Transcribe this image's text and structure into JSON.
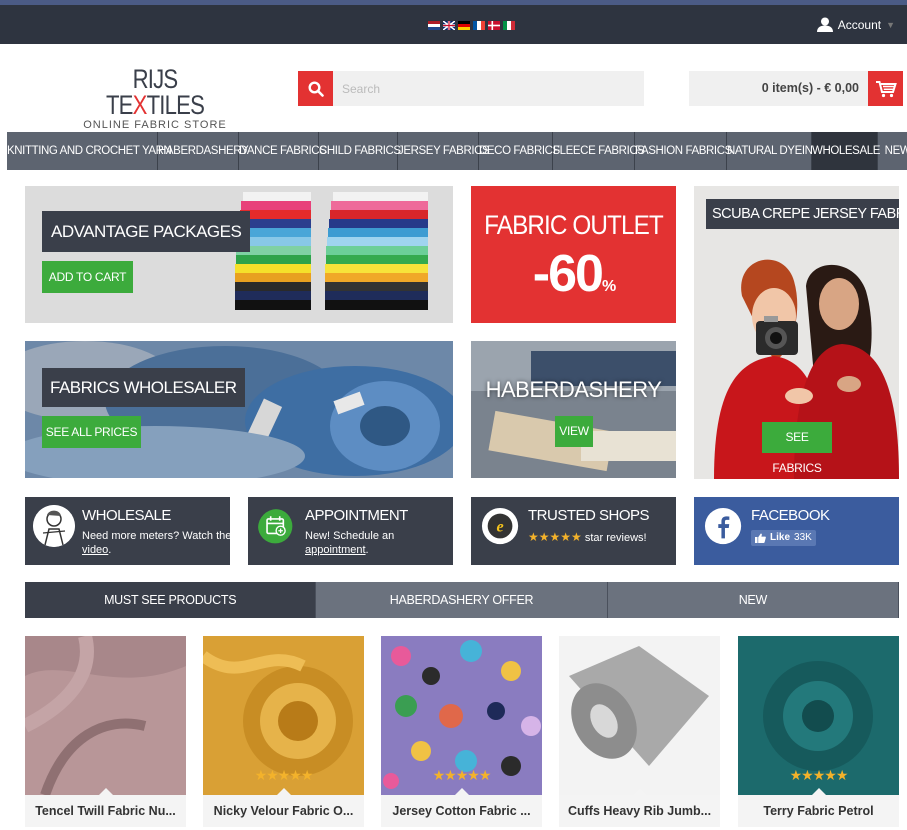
{
  "topbar": {
    "account_label": "Account",
    "flags": [
      "nl",
      "uk",
      "de",
      "fr",
      "dk",
      "it"
    ]
  },
  "logo": {
    "line1_a": "RIJS TE",
    "line1_x": "X",
    "line1_b": "TILES",
    "line2": "ONLINE FABRIC STORE"
  },
  "search": {
    "placeholder": "Search"
  },
  "cart": {
    "summary": "0 item(s) - € 0,00"
  },
  "nav": {
    "items": [
      {
        "label": "KNITTING AND CROCHET YARN",
        "active": false
      },
      {
        "label": "HABERDASHERY",
        "active": false
      },
      {
        "label": "DANCE FABRICS",
        "active": false
      },
      {
        "label": "CHILD FABRICS",
        "active": false
      },
      {
        "label": "JERSEY FABRICS",
        "active": false
      },
      {
        "label": "DECO FABRICS",
        "active": false
      },
      {
        "label": "FLEECE FABRICS",
        "active": false
      },
      {
        "label": "FASHION FABRICS",
        "active": false
      },
      {
        "label": "NATURAL DYEING",
        "active": false
      },
      {
        "label": "WHOLESALE",
        "active": true
      },
      {
        "label": "NEW",
        "active": false
      }
    ]
  },
  "banners": {
    "advantage": {
      "title": "ADVANTAGE PACKAGES",
      "button": "ADD TO CART"
    },
    "outlet": {
      "title": "FABRIC OUTLET",
      "discount": "-60",
      "percent": "%"
    },
    "scuba": {
      "title": "SCUBA CREPE JERSEY FABRIC",
      "button": "SEE FABRICS"
    },
    "wholesaler": {
      "title": "FABRICS WHOLESALER",
      "button": "SEE ALL PRICES"
    },
    "haberdashery": {
      "title": "HABERDASHERY",
      "button": "VIEW"
    }
  },
  "info_boxes": {
    "wholesale": {
      "title": "WHOLESALE",
      "text": "Need more meters? Watch the ",
      "link": "video",
      "end": "."
    },
    "appointment": {
      "title": "APPOINTMENT",
      "text": "New! Schedule an ",
      "link": "appointment",
      "end": "."
    },
    "trusted": {
      "title": "TRUSTED SHOPS",
      "stars": "★★★★★",
      "text": " star reviews!"
    },
    "facebook": {
      "title": "FACEBOOK",
      "like_label": "Like",
      "like_count": "33K"
    }
  },
  "tabs": [
    {
      "label": "MUST SEE PRODUCTS",
      "active": true
    },
    {
      "label": "HABERDASHERY OFFER",
      "active": false
    },
    {
      "label": "NEW",
      "active": false
    }
  ],
  "products": [
    {
      "name": "Tencel Twill Fabric Nu...",
      "stars": "",
      "color": "#a8878a"
    },
    {
      "name": "Nicky Velour Fabric O...",
      "stars": "★★★★★",
      "color": "#d9a035"
    },
    {
      "name": "Jersey Cotton Fabric ...",
      "stars": "★★★★★",
      "color": "#7b6fb0"
    },
    {
      "name": "Cuffs Heavy Rib Jumb...",
      "stars": "",
      "color": "#a9a9a9"
    },
    {
      "name": "Terry Fabric Petrol",
      "stars": "★★★★★",
      "color": "#1c6a6c"
    }
  ],
  "colors": {
    "dark": "#2e3440",
    "accent_red": "#e33232",
    "green": "#3cab3c",
    "facebook_blue": "#3b5c9e"
  }
}
